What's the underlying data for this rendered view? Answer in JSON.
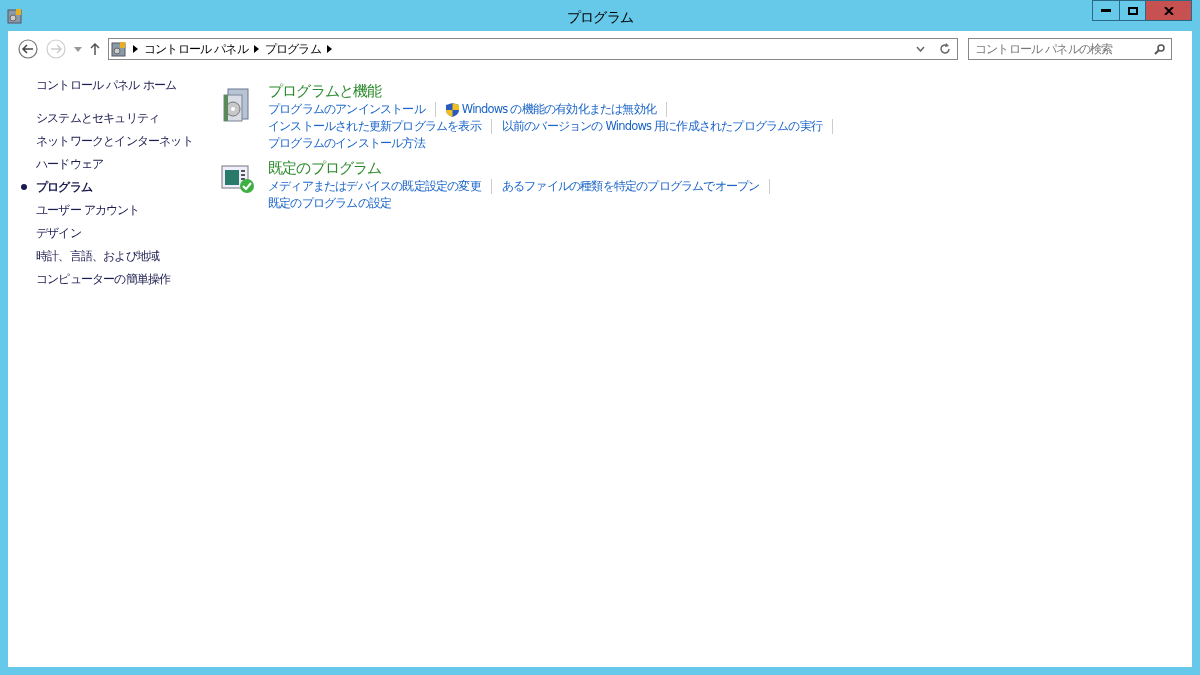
{
  "window": {
    "title": "プログラム"
  },
  "address_bar": {
    "crumbs": [
      "コントロール パネル",
      "プログラム"
    ]
  },
  "search": {
    "placeholder": "コントロール パネルの検索"
  },
  "sidebar": {
    "home": "コントロール パネル ホーム",
    "items": [
      {
        "label": "システムとセキュリティ",
        "selected": false
      },
      {
        "label": "ネットワークとインターネット",
        "selected": false
      },
      {
        "label": "ハードウェア",
        "selected": false
      },
      {
        "label": "プログラム",
        "selected": true
      },
      {
        "label": "ユーザー アカウント",
        "selected": false
      },
      {
        "label": "デザイン",
        "selected": false
      },
      {
        "label": "時計、言語、および地域",
        "selected": false
      },
      {
        "label": "コンピューターの簡単操作",
        "selected": false
      }
    ]
  },
  "sections": [
    {
      "kind": "programs",
      "title": "プログラムと機能",
      "links": [
        {
          "label": "プログラムのアンインストール",
          "kind": "plain"
        },
        {
          "label": "Windows の機能の有効化または無効化",
          "kind": "shield"
        },
        {
          "label": "インストールされた更新プログラムを表示",
          "kind": "plain"
        },
        {
          "label": "以前のバージョンの Windows 用に作成されたプログラムの実行",
          "kind": "plain"
        },
        {
          "label": "プログラムのインストール方法",
          "kind": "plain"
        }
      ]
    },
    {
      "kind": "defaults",
      "title": "既定のプログラム",
      "links": [
        {
          "label": "メディアまたはデバイスの既定設定の変更",
          "kind": "plain"
        },
        {
          "label": "あるファイルの種類を特定のプログラムでオープン",
          "kind": "plain"
        },
        {
          "label": "既定のプログラムの設定",
          "kind": "plain"
        }
      ]
    }
  ]
}
